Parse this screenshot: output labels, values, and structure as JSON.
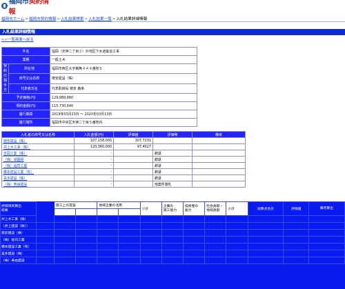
{
  "site": {
    "logo_text": "福岡市",
    "logo_red": "契約情報"
  },
  "breadcrumb": {
    "items": [
      "福岡市ホーム",
      "福岡市契約情報",
      "入札結果検索",
      "入札結果一覧"
    ],
    "separator": ">",
    "current": "入札結果詳細情報"
  },
  "section_title": "入札結果詳細情報",
  "back_link": "<<一覧画面へ戻る",
  "detail": {
    "group_label": "契約の相手方",
    "rows": [
      {
        "label": "件名",
        "value": "福岡（天神二丁目２）外地区下水道築造工事"
      },
      {
        "label": "業種",
        "value": "一般土木"
      },
      {
        "label": "所在地",
        "value": "福岡市西区大字鵜無４４４番地５"
      },
      {
        "label": "商号又は名称",
        "value": "徳安建設（株）"
      },
      {
        "label": "代表者氏名",
        "value": "代表取締役 徳安 義幸"
      },
      {
        "label": "予定価格(円)",
        "value": "129,989,880"
      },
      {
        "label": "契約金額(円)",
        "value": "115,730,640"
      },
      {
        "label": "履行期間",
        "value": "2019年03月23日 ～ 2020年03月13日"
      },
      {
        "label": "履行場所",
        "value": "福岡市中央区天神二丁目５番地内"
      }
    ]
  },
  "bids": {
    "headers": [
      "入札者の商号又は名称",
      "入札金額(円)",
      "評価値",
      "評価等",
      "備考"
    ],
    "rows": [
      {
        "name": "徳安建設（株）",
        "amount": "107,158,000",
        "score": "107.7231",
        "note": "",
        "remark": ""
      },
      {
        "name": "井上木工事（株）",
        "amount": "120,360,000",
        "score": "97.4027",
        "note": "",
        "remark": ""
      },
      {
        "name": "吉岡工業（株）",
        "amount": "-",
        "score": "",
        "note": "辞退",
        "remark": ""
      },
      {
        "name": "（株）城園組",
        "amount": "-",
        "score": "",
        "note": "辞退",
        "remark": ""
      },
      {
        "name": "（株）福司工業",
        "amount": "-",
        "score": "",
        "note": "辞退",
        "remark": ""
      },
      {
        "name": "橋本建設工業（有）",
        "amount": "-",
        "score": "",
        "note": "辞退",
        "remark": ""
      },
      {
        "name": "喜多建設（株）",
        "amount": "-",
        "score": "",
        "note": "辞退",
        "remark": ""
      },
      {
        "name": "（株）寿由建設",
        "amount": "-",
        "score": "",
        "note": "他案件落札",
        "remark": ""
      }
    ]
  },
  "evaluation": {
    "top_left": "評価項目算出\n結果",
    "sub_headers": [
      "施工上の提案",
      "地域企業の活用"
    ],
    "headers": [
      "小計",
      "企業の\n施工能力",
      "技術者の\n能力",
      "社会貢献・\n地域貢献",
      "小計",
      "加算点合計",
      "評価値",
      "備考算出"
    ],
    "rows": [
      {
        "cells": [
          "井上木工事（株）",
          "",
          "",
          "",
          "",
          "",
          "",
          "",
          "",
          "",
          "",
          "",
          ""
        ]
      },
      {
        "cells": [
          "（井上建設（株））",
          "",
          "",
          "",
          "",
          "",
          "",
          "",
          "",
          "",
          "",
          "",
          ""
        ]
      },
      {
        "cells": [
          "徳安建設（株）",
          "",
          "",
          "",
          "",
          "",
          "",
          "",
          "",
          "",
          "",
          "",
          ""
        ]
      },
      {
        "cells": [
          "（株）福司工業",
          "",
          "",
          "",
          "",
          "",
          "",
          "",
          "",
          "",
          "",
          "",
          ""
        ]
      },
      {
        "cells": [
          "橋本建設工業（有）",
          "",
          "",
          "",
          "",
          "",
          "",
          "",
          "",
          "",
          "",
          "",
          ""
        ]
      },
      {
        "cells": [
          "喜多建設（株）",
          "",
          "",
          "",
          "",
          "",
          "",
          "",
          "",
          "",
          "",
          "",
          ""
        ]
      },
      {
        "cells": [
          "（株）寿由建設",
          "",
          "",
          "",
          "",
          "",
          "",
          "",
          "",
          "",
          "",
          "",
          ""
        ]
      }
    ]
  }
}
